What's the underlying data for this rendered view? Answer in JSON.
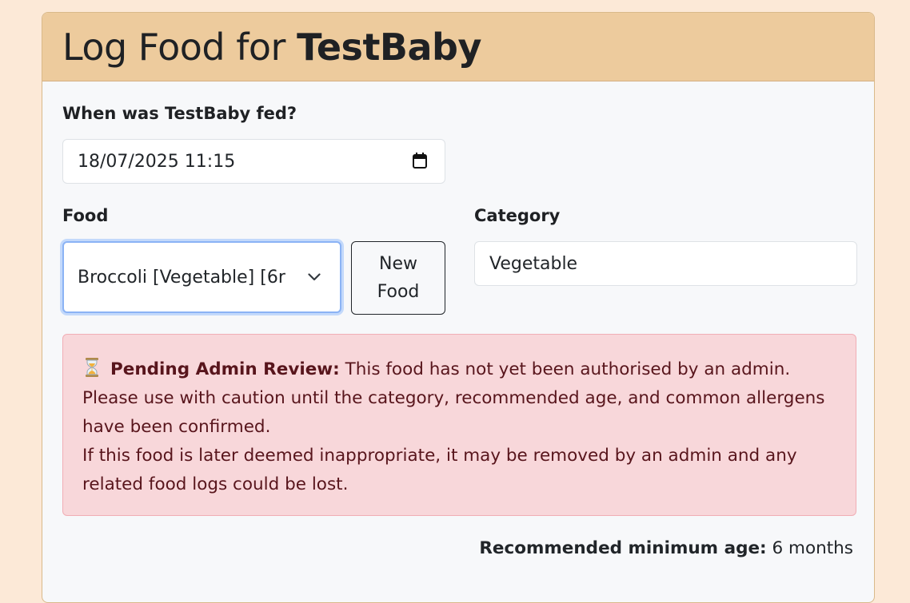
{
  "header": {
    "title_prefix": "Log Food for ",
    "baby_name": "TestBaby"
  },
  "form": {
    "fed_time_label": "When was TestBaby fed?",
    "fed_time_value": "18/07/2025 11:15",
    "food_label": "Food",
    "food_selected": "Broccoli [Vegetable] [6r",
    "new_food_line1": "New",
    "new_food_line2": "Food",
    "category_label": "Category",
    "category_value": "Vegetable"
  },
  "alert": {
    "icon": "hourglass-icon",
    "title": "Pending Admin Review:",
    "line1": " This food has not yet been authorised by an admin. Please use with caution until the category, recommended age, and common allergens have been confirmed.",
    "line2": "If this food is later deemed inappropriate, it may be removed by an admin and any related food logs could be lost."
  },
  "recommendation": {
    "label": "Recommended minimum age:",
    "value": " 6 months"
  },
  "colors": {
    "page_background": "#fce9d7",
    "header_background": "#edcb9d",
    "alert_background": "#f8d7da",
    "alert_text": "#58151c",
    "focus_border": "#8bb3f5"
  }
}
